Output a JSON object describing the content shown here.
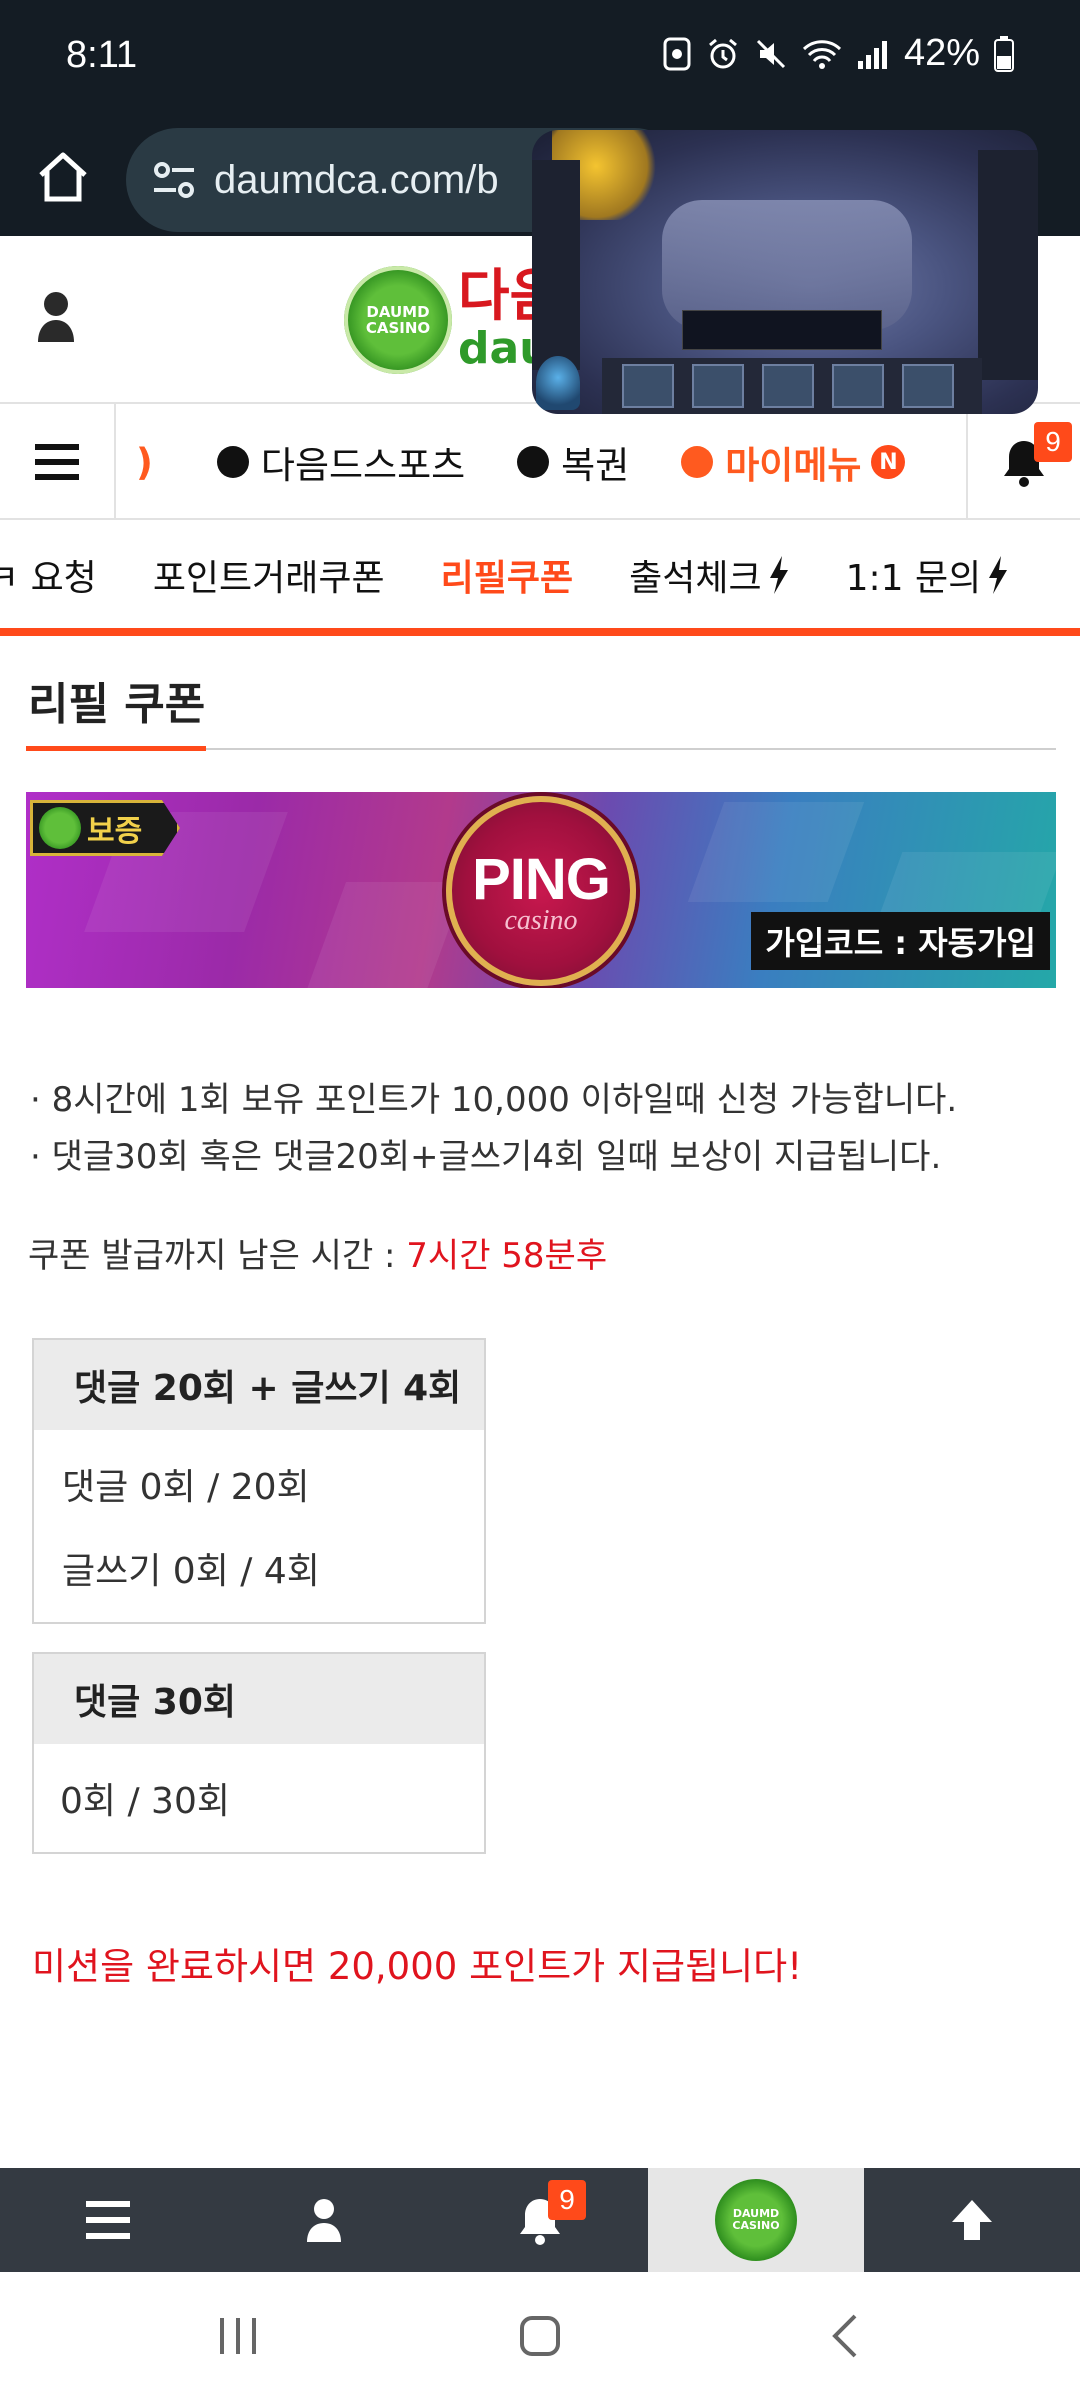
{
  "status_bar": {
    "time": "8:11",
    "battery": "42%"
  },
  "browser": {
    "url": "daumdca.com/b"
  },
  "header": {
    "logo_badge_text": "DAUMD CASINO",
    "logo_ko": "다음",
    "logo_en": "daur"
  },
  "main_nav": {
    "cut_item": ")",
    "items": [
      {
        "label": "다음드스포츠"
      },
      {
        "label": "복권"
      },
      {
        "label": "마이메뉴",
        "badge": "N"
      }
    ],
    "bell_count": "9"
  },
  "sub_tabs": {
    "items": [
      "ㅋ 요청",
      "포인트거래쿠폰",
      "리필쿠폰",
      "출석체크",
      "1:1 문의"
    ],
    "active_index": 2
  },
  "page": {
    "title": "리필 쿠폰",
    "banner": {
      "guarantee_label": "보증",
      "brand": "PING",
      "brand_sub": "casino",
      "join_code": "가입코드 : 자동가입"
    },
    "info": [
      "· 8시간에 1회 보유 포인트가 10,000 이하일때 신청 가능합니다.",
      "· 댓글30회 혹은 댓글20회+글쓰기4회 일때 보상이 지급됩니다."
    ],
    "countdown_label": "쿠폰 발급까지 남은 시간 : ",
    "countdown_value": "7시간 58분후",
    "mission_1": {
      "header": "댓글 20회 + 글쓰기 4회",
      "rows": [
        "댓글 0회 / 20회",
        "글쓰기 0회 / 4회"
      ]
    },
    "mission_2": {
      "header": "댓글 30회",
      "rows": [
        "0회 / 30회"
      ]
    },
    "reward_text": "미션을 완료하시면 20,000 포인트가 지급됩니다!"
  },
  "bottom_bar": {
    "bell_count": "9",
    "logo_text": "DAUMD CASINO"
  },
  "colors": {
    "accent": "#ff4a1a",
    "red_text": "#e0141e",
    "dark_bar": "#141c24",
    "bottom_bar": "#343a42"
  }
}
